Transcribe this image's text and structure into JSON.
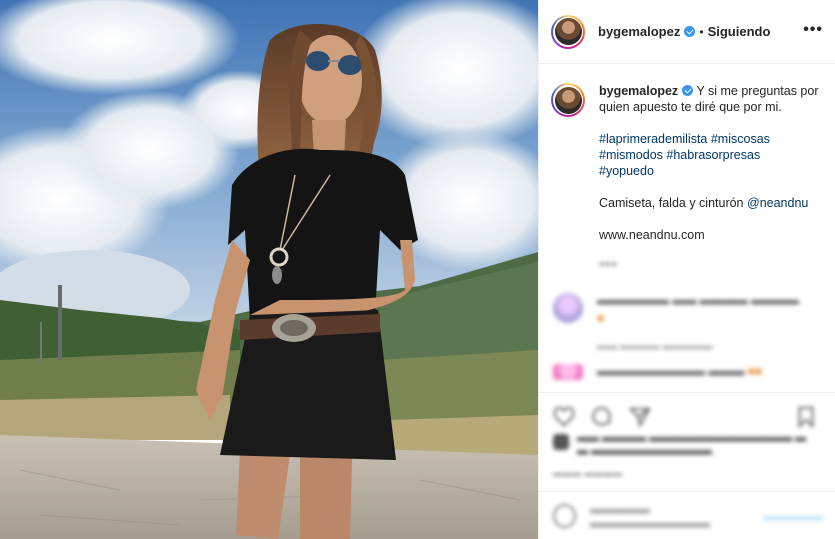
{
  "post": {
    "username": "bygemalopez",
    "follow_status": "Siguiendo",
    "more_label": "•••",
    "dot": "•"
  },
  "caption": {
    "username": "bygemalopez",
    "text": "Y si me preguntas por quien apuesto te diré que por mi.",
    "hashtags_line1": "#laprimerademilista #miscosas",
    "hashtags_line2": "#mismodos #habrasorpresas",
    "hashtags_line3": "#yopuedo",
    "credit_text": "Camiseta, falda y cinturón ",
    "credit_mention": "@neandnu",
    "website": "www.neandnu.com"
  },
  "colors": {
    "link": "#00376b",
    "verified": "#3897f0",
    "muted": "#8e8e8e",
    "border": "#efefef"
  },
  "icons": {
    "verified": "verified-badge-icon",
    "more": "more-options-icon",
    "like": "heart-icon",
    "comment": "comment-icon",
    "share": "share-icon",
    "save": "bookmark-icon",
    "emoji": "emoji-icon"
  }
}
